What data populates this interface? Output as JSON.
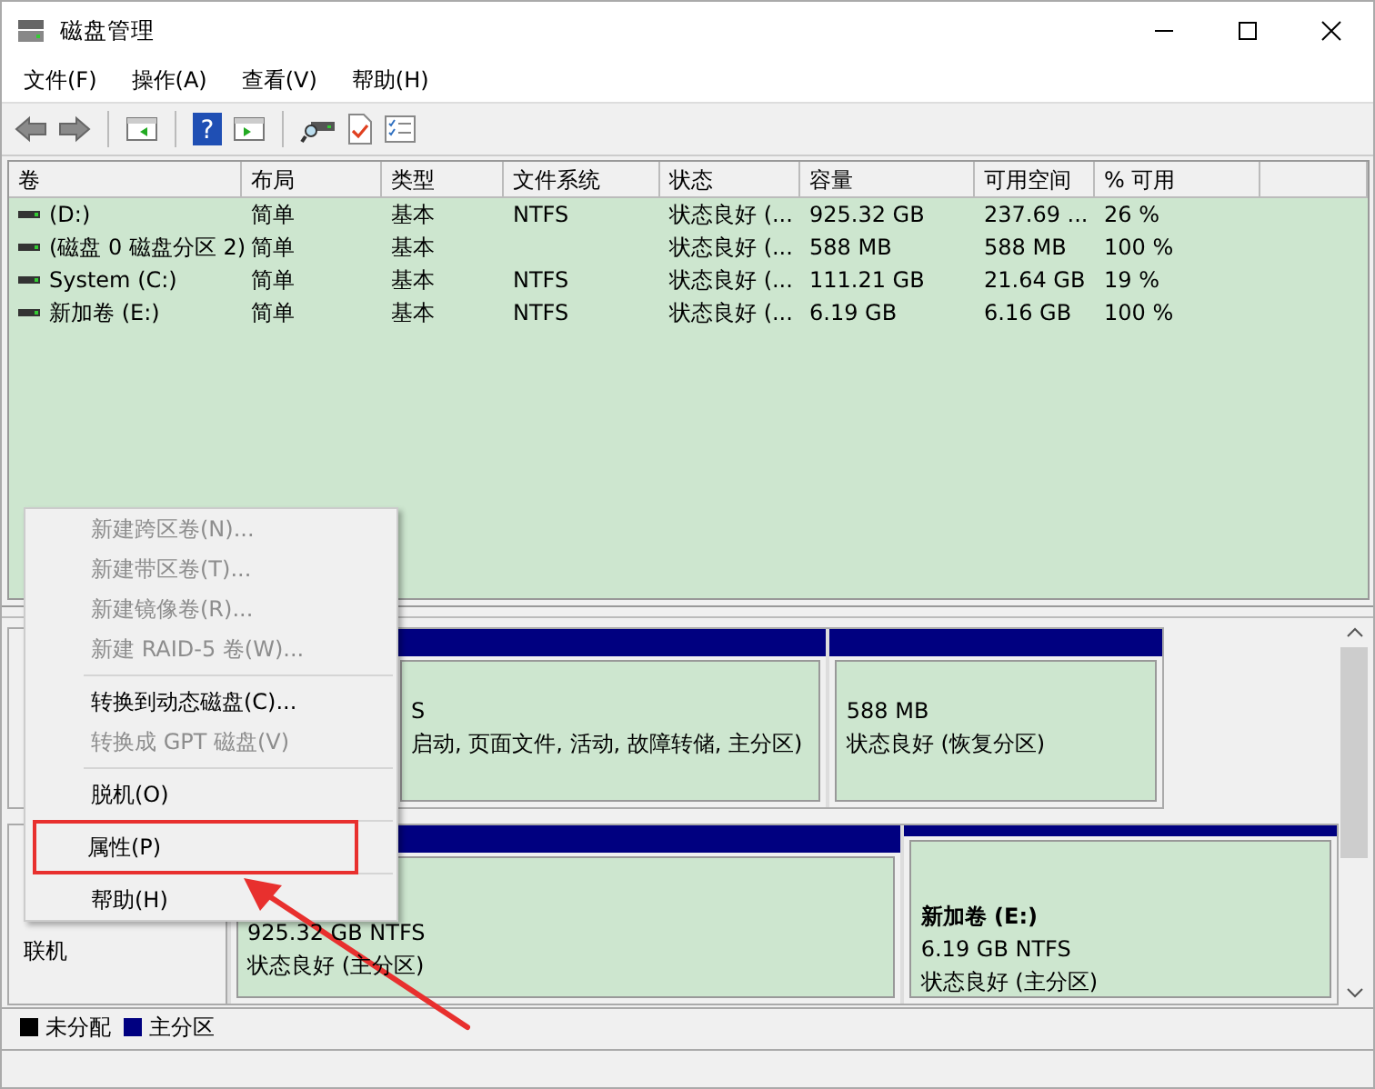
{
  "window": {
    "title": "磁盘管理"
  },
  "menu_bar": [
    "文件(F)",
    "操作(A)",
    "查看(V)",
    "帮助(H)"
  ],
  "volume_table": {
    "columns": [
      "卷",
      "布局",
      "类型",
      "文件系统",
      "状态",
      "容量",
      "可用空间",
      "% 可用"
    ],
    "rows": [
      [
        "(D:)",
        "简单",
        "基本",
        "NTFS",
        "状态良好 (...",
        "925.32 GB",
        "237.69 ...",
        "26 %"
      ],
      [
        "(磁盘 0 磁盘分区 2)",
        "简单",
        "基本",
        "",
        "状态良好 (...",
        "588 MB",
        "588 MB",
        "100 %"
      ],
      [
        "System (C:)",
        "简单",
        "基本",
        "NTFS",
        "状态良好 (...",
        "111.21 GB",
        "21.64 GB",
        "19 %"
      ],
      [
        "新加卷 (E:)",
        "简单",
        "基本",
        "NTFS",
        "状态良好 (...",
        "6.19 GB",
        "6.16 GB",
        "100 %"
      ]
    ]
  },
  "toolbar": {
    "help_glyph": "?"
  },
  "disks": [
    {
      "partitions": [
        {
          "lines": [
            "S",
            "启动, 页面文件, 活动, 故障转储, 主分区)"
          ]
        },
        {
          "lines": [
            "588 MB",
            "状态良好 (恢复分区)"
          ]
        }
      ]
    },
    {
      "label_lines": [
        "联机"
      ],
      "partitions": [
        {
          "lines": [
            "925.32 GB NTFS",
            "状态良好 (主分区)"
          ]
        },
        {
          "name": "新加卷  (E:)",
          "lines": [
            "6.19 GB NTFS",
            "状态良好 (主分区)"
          ]
        }
      ]
    }
  ],
  "legend": [
    {
      "label": "未分配",
      "color": "#000000"
    },
    {
      "label": "主分区",
      "color": "#000080"
    }
  ],
  "context_menu": [
    {
      "kind": "item",
      "label": "新建跨区卷(N)...",
      "disabled": true,
      "annotated": false
    },
    {
      "kind": "item",
      "label": "新建带区卷(T)...",
      "disabled": true,
      "annotated": false
    },
    {
      "kind": "item",
      "label": "新建镜像卷(R)...",
      "disabled": true,
      "annotated": false
    },
    {
      "kind": "item",
      "label": "新建 RAID-5 卷(W)...",
      "disabled": true,
      "annotated": false
    },
    {
      "kind": "separator"
    },
    {
      "kind": "item",
      "label": "转换到动态磁盘(C)...",
      "disabled": false,
      "annotated": false
    },
    {
      "kind": "item",
      "label": "转换成 GPT 磁盘(V)",
      "disabled": true,
      "annotated": false
    },
    {
      "kind": "separator"
    },
    {
      "kind": "item",
      "label": "脱机(O)",
      "disabled": false,
      "annotated": false
    },
    {
      "kind": "separator"
    },
    {
      "kind": "item",
      "label": "属性(P)",
      "disabled": false,
      "annotated": true
    },
    {
      "kind": "separator"
    },
    {
      "kind": "item",
      "label": "帮助(H)",
      "disabled": false,
      "annotated": false
    }
  ]
}
